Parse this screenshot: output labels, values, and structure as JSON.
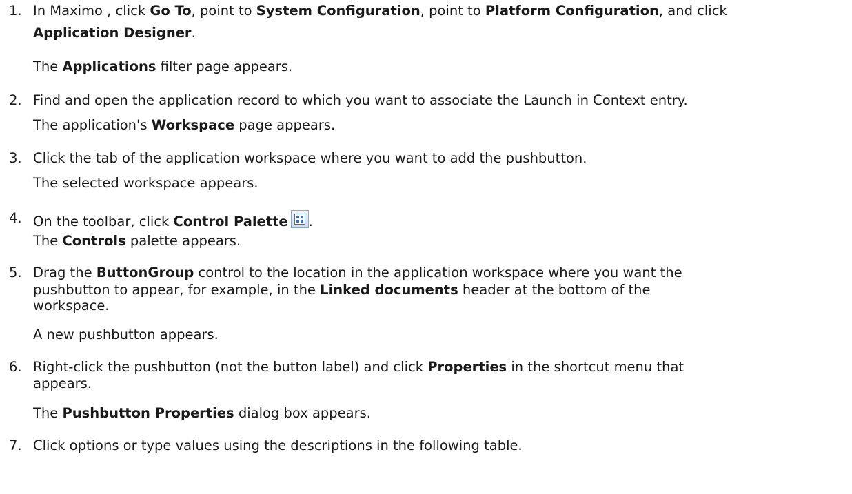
{
  "steps": [
    {
      "num": "1.",
      "lines": [
        [
          {
            "t": "In Maximo , click "
          },
          {
            "t": "Go To",
            "b": true
          },
          {
            "t": ", point to "
          },
          {
            "t": "System Configuration",
            "b": true
          },
          {
            "t": ", point to "
          },
          {
            "t": "Platform Configuration",
            "b": true
          },
          {
            "t": ", and click"
          }
        ],
        [
          {
            "t": "Application Designer",
            "b": true
          },
          {
            "t": "."
          }
        ]
      ],
      "result": [
        {
          "t": "The "
        },
        {
          "t": "Applications",
          "b": true
        },
        {
          "t": " filter page appears."
        }
      ]
    },
    {
      "num": "2.",
      "lines": [
        [
          {
            "t": "Find and open the application record to which you want to associate the Launch in Context entry."
          }
        ]
      ],
      "result": [
        {
          "t": "The application's "
        },
        {
          "t": "Workspace",
          "b": true
        },
        {
          "t": " page appears."
        }
      ]
    },
    {
      "num": "3.",
      "lines": [
        [
          {
            "t": "Click the tab of the application workspace where you want to add the pushbutton."
          }
        ]
      ],
      "result": [
        {
          "t": "The selected workspace appears."
        }
      ]
    },
    {
      "num": "4.",
      "lines": [
        [
          {
            "t": "On the toolbar, click "
          },
          {
            "t": "Control Palette",
            "b": true
          },
          {
            "icon": "control-palette-icon"
          },
          {
            "t": "."
          }
        ]
      ],
      "result": [
        {
          "t": "The "
        },
        {
          "t": "Controls",
          "b": true
        },
        {
          "t": " palette appears."
        }
      ]
    },
    {
      "num": "5.",
      "lines": [
        [
          {
            "t": "Drag the "
          },
          {
            "t": "ButtonGroup",
            "b": true
          },
          {
            "t": " control to the location in the application workspace where you want the"
          }
        ],
        [
          {
            "t": "pushbutton to appear, for example, in the "
          },
          {
            "t": "Linked documents",
            "b": true
          },
          {
            "t": " header at the bottom of the"
          }
        ],
        [
          {
            "t": "workspace."
          }
        ]
      ],
      "result": [
        {
          "t": "A new pushbutton appears."
        }
      ]
    },
    {
      "num": "6.",
      "lines": [
        [
          {
            "t": "Right-click the pushbutton (not the button label) and click "
          },
          {
            "t": "Properties",
            "b": true
          },
          {
            "t": " in the shortcut menu that"
          }
        ],
        [
          {
            "t": "appears."
          }
        ]
      ],
      "result": [
        {
          "t": "The "
        },
        {
          "t": "Pushbutton Properties",
          "b": true
        },
        {
          "t": " dialog box appears."
        }
      ]
    },
    {
      "num": "7.",
      "lines": [
        [
          {
            "t": "Click options or type values using the descriptions in the following table."
          }
        ]
      ],
      "result": null
    }
  ]
}
